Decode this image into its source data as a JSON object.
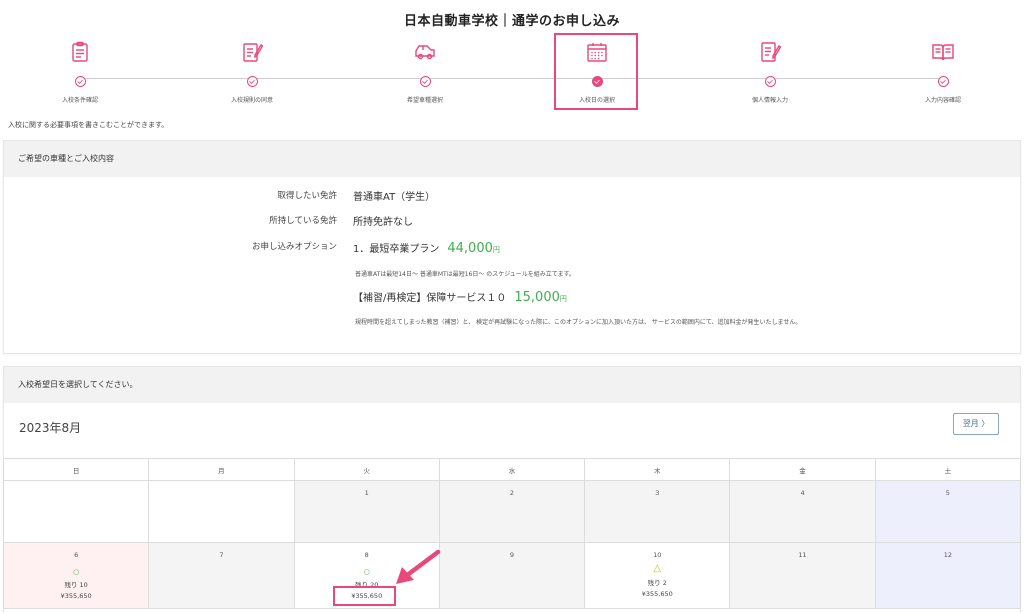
{
  "header": {
    "title": "日本自動車学校｜通学のお申し込み"
  },
  "steps": [
    {
      "label": "入校条件確認",
      "icon": "clipboard-icon"
    },
    {
      "label": "入校規則の同意",
      "icon": "document-pen-icon"
    },
    {
      "label": "希望車種選択",
      "icon": "car-icon"
    },
    {
      "label": "入校日の選択",
      "icon": "calendar-icon",
      "active": true
    },
    {
      "label": "個人情報入力",
      "icon": "form-pen-icon"
    },
    {
      "label": "入力内容確認",
      "icon": "open-book-icon"
    }
  ],
  "intro": "入校に関する必要事項を書きこむことができます。",
  "course": {
    "header": "ご希望の車種とご入校内容",
    "license_label": "取得したい免許",
    "license_value": "普通車AT（学生）",
    "held_label": "所持している免許",
    "held_value": "所持免許なし",
    "option_label": "お申し込みオプション",
    "option1_name": "1．最短卒業プラン",
    "option1_price": "44,000",
    "option1_note": "普通車ATは最短14日～ 普通車MTは最短16日～ のスケジュールを組み立てます。",
    "option2_name": "【補習/再検定】保障サービス１０",
    "option2_price": "15,000",
    "option2_note": "規程時間を超えてしまった教習（補習）と、 検定が再試験になった際に、このオプションに加入頂いた方は、 サービスの範囲内にて、追加料金が発生いたしません。",
    "yen": "円"
  },
  "calendar": {
    "header": "入校希望日を選択してください。",
    "month": "2023年8月",
    "next_label": "翌月",
    "weekdays": [
      "日",
      "月",
      "火",
      "水",
      "木",
      "金",
      "土"
    ],
    "week1": [
      "",
      "",
      "1",
      "2",
      "3",
      "4",
      "5"
    ],
    "week2": [
      {
        "day": "6",
        "mark": "○",
        "remain": "残り 10",
        "fee": "¥355,650"
      },
      {
        "day": "7"
      },
      {
        "day": "8",
        "mark": "○",
        "remain": "残り 20",
        "fee": "¥355,650"
      },
      {
        "day": "9"
      },
      {
        "day": "10",
        "mark": "△",
        "remain": "残り 2",
        "fee": "¥355,650"
      },
      {
        "day": "11"
      },
      {
        "day": "12"
      }
    ]
  },
  "colors": {
    "accent": "#e8487a",
    "price": "#3fb04f",
    "warning": "#e8b100",
    "sunday_bg": "#fff1f1",
    "saturday_bg": "#eeeffc"
  }
}
